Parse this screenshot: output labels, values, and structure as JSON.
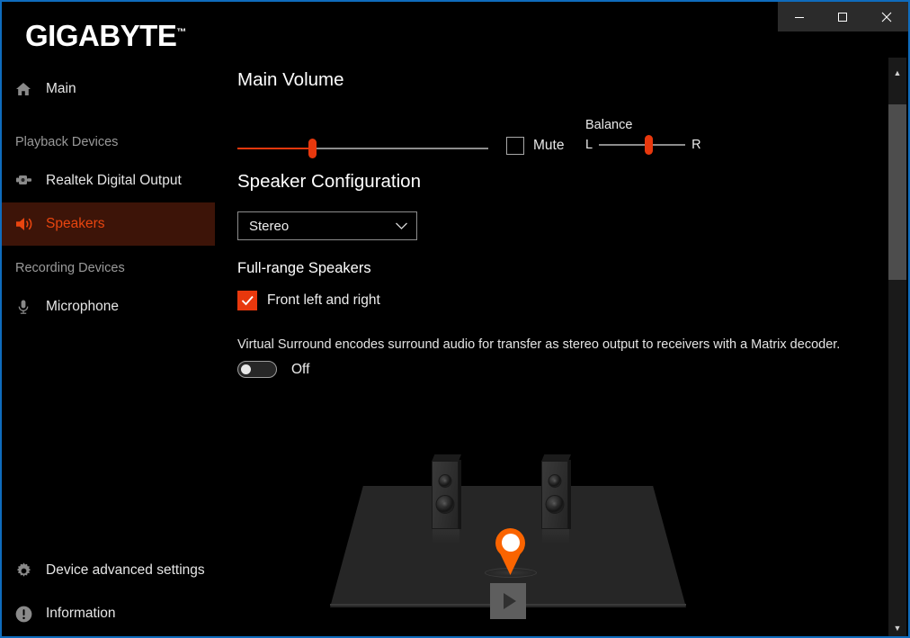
{
  "window": {
    "title_buttons": [
      {
        "name": "minimize",
        "glyph": "minimize-icon"
      },
      {
        "name": "maximize",
        "glyph": "maximize-icon"
      },
      {
        "name": "close",
        "glyph": "close-icon"
      }
    ],
    "accent_border_color": "#0f6cbd",
    "background_color": "#000000"
  },
  "brand": {
    "name": "GIGABYTE",
    "trademark": "™"
  },
  "sidebar": {
    "main_item": {
      "label": "Main",
      "icon": "home-icon"
    },
    "groups": [
      {
        "title": "Playback Devices",
        "items": [
          {
            "label": "Realtek Digital Output",
            "icon": "optical-plug-icon",
            "selected": false
          },
          {
            "label": "Speakers",
            "icon": "speaker-icon",
            "selected": true
          }
        ]
      },
      {
        "title": "Recording Devices",
        "items": [
          {
            "label": "Microphone",
            "icon": "microphone-icon",
            "selected": false
          }
        ]
      }
    ],
    "bottom_items": [
      {
        "label": "Device advanced settings",
        "icon": "gear-icon"
      },
      {
        "label": "Information",
        "icon": "info-circle-icon"
      }
    ],
    "selected_background": "#3d1408",
    "selected_text_color": "#e8450f"
  },
  "main": {
    "volume": {
      "title": "Main Volume",
      "value_percent": 30,
      "fill_color": "#e8380d",
      "track_color": "#8c8c8c"
    },
    "mute": {
      "label": "Mute",
      "checked": false
    },
    "balance": {
      "label": "Balance",
      "left_label": "L",
      "right_label": "R",
      "value_percent": 58
    },
    "speaker_configuration": {
      "title": "Speaker Configuration",
      "selected": "Stereo",
      "chevron": "chevron-down-icon"
    },
    "full_range": {
      "title": "Full-range Speakers",
      "checkbox_label": "Front left and right",
      "checked": true,
      "check_color": "#e8380d"
    },
    "virtual_surround": {
      "description": "Virtual Surround encodes surround audio for transfer as stereo output to receivers with a Matrix decoder.",
      "state_label": "Off",
      "enabled": false
    },
    "room_preview": {
      "speakers": [
        "front-left-speaker",
        "front-right-speaker"
      ],
      "listener_marker": "listener-pin",
      "play_button": "play-icon",
      "pin_color": "#fa6400"
    }
  },
  "scrollbar": {
    "up_arrow": "▲",
    "down_arrow": "▼",
    "thumb_position_percent": 4,
    "thumb_size_percent": 33
  }
}
